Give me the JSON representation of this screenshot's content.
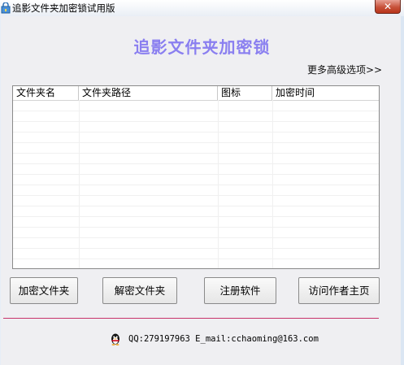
{
  "window": {
    "title": "追影文件夹加密锁试用版",
    "close_glyph": "✕"
  },
  "header": {
    "title": "追影文件夹加密锁"
  },
  "more_options": "更多高级选项>>",
  "folder_list": {
    "columns": [
      "文件夹名",
      "文件夹路径",
      "图标",
      "加密时间"
    ],
    "rows": []
  },
  "buttons": {
    "encrypt": "加密文件夹",
    "decrypt": "解密文件夹",
    "register": "注册软件",
    "visit": "访问作者主页"
  },
  "footer": {
    "contact": "QQ:279197963 E_mail:cchaoming@163.com"
  },
  "colors": {
    "title": "#8a7ff0",
    "divider": "#c8336a",
    "close_button": "#c7523a"
  },
  "icons": {
    "app": "folder-lock-icon",
    "qq": "qq-penguin-icon"
  }
}
